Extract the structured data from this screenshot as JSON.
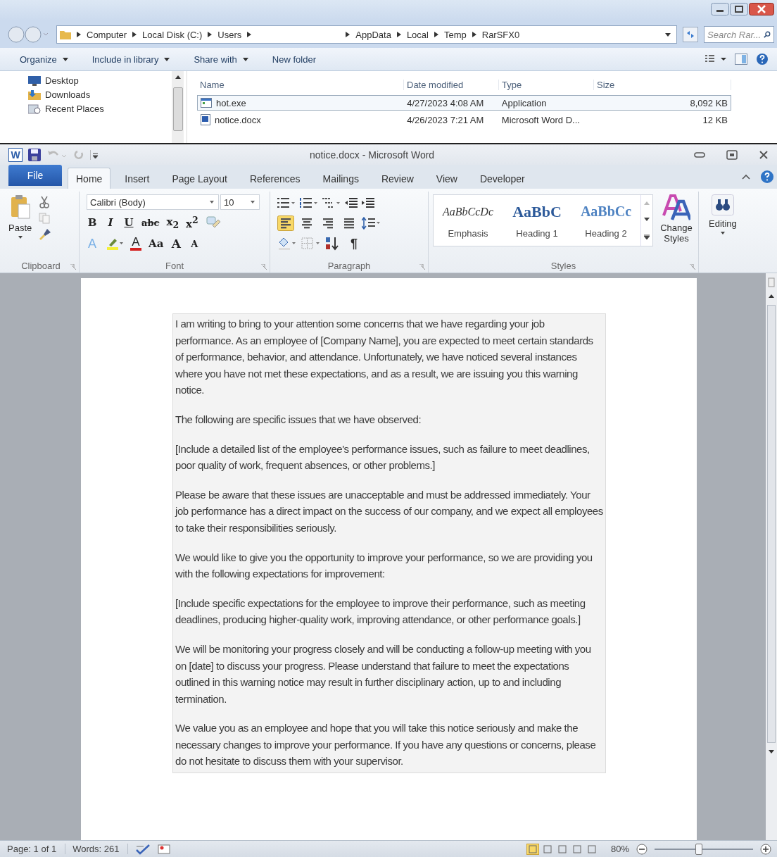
{
  "explorer": {
    "breadcrumb": [
      {
        "kind": "crumb",
        "label": "Computer"
      },
      {
        "kind": "crumb",
        "label": "Local Disk (C:)"
      },
      {
        "kind": "crumb",
        "label": "Users"
      },
      {
        "kind": "blank"
      },
      {
        "kind": "crumb",
        "label": "AppData"
      },
      {
        "kind": "crumb",
        "label": "Local"
      },
      {
        "kind": "crumb",
        "label": "Temp"
      },
      {
        "kind": "crumb",
        "label": "RarSFX0"
      }
    ],
    "search": {
      "placeholder": "Search Rar..."
    },
    "toolbar": [
      {
        "label": "Organize",
        "dropdown": true
      },
      {
        "label": "Include in library",
        "dropdown": true
      },
      {
        "label": "Share with",
        "dropdown": true
      },
      {
        "label": "New folder",
        "dropdown": false
      }
    ],
    "nav": [
      {
        "label": "Desktop",
        "kind": "desktop"
      },
      {
        "label": "Downloads",
        "kind": "downloads"
      },
      {
        "label": "Recent Places",
        "kind": "recent"
      }
    ],
    "columns": [
      "Name",
      "Date modified",
      "Type",
      "Size"
    ],
    "files": [
      {
        "name": "hot.exe",
        "kind": "exe",
        "date": "4/27/2023 4:08 AM",
        "type": "Application",
        "size": "8,092 KB",
        "selected": true
      },
      {
        "name": "notice.docx",
        "kind": "doc",
        "date": "4/26/2023 7:21 AM",
        "type": "Microsoft Word D...",
        "size": "12 KB",
        "selected": false
      }
    ]
  },
  "word": {
    "logo": "W",
    "title": "notice.docx - Microsoft Word",
    "tabs": [
      {
        "label": "File",
        "kind": "file",
        "selected": false
      },
      {
        "label": "Home",
        "kind": "tab",
        "selected": true
      },
      {
        "label": "Insert",
        "kind": "tab",
        "selected": false
      },
      {
        "label": "Page Layout",
        "kind": "tab",
        "selected": false
      },
      {
        "label": "References",
        "kind": "tab",
        "selected": false
      },
      {
        "label": "Mailings",
        "kind": "tab",
        "selected": false
      },
      {
        "label": "Review",
        "kind": "tab",
        "selected": false
      },
      {
        "label": "View",
        "kind": "tab",
        "selected": false
      },
      {
        "label": "Developer",
        "kind": "tab",
        "selected": false
      }
    ],
    "clipboard": {
      "label": "Clipboard",
      "paste": "Paste"
    },
    "font": {
      "label": "Font",
      "name": "Calibri (Body)",
      "size": "10",
      "row1": [
        {
          "kind": "bold",
          "text": "B"
        },
        {
          "kind": "italic",
          "text": "I"
        },
        {
          "kind": "underline",
          "text": "U"
        },
        {
          "kind": "strike",
          "text": "abc"
        },
        {
          "kind": "plain",
          "text": "x$_{2}$"
        },
        {
          "kind": "plain",
          "text": "x$^{2}$"
        }
      ],
      "row2": [
        {
          "kind": "effects",
          "text": "A"
        },
        {
          "kind": "highlight"
        },
        {
          "kind": "color",
          "text": "A"
        },
        {
          "kind": "plain",
          "text": "Aa"
        },
        {
          "kind": "grow",
          "text": "A"
        },
        {
          "kind": "shrink",
          "text": "A"
        }
      ]
    },
    "paragraph": {
      "label": "Paragraph",
      "align": [
        {
          "kind": "left",
          "selected": true
        },
        {
          "kind": "center",
          "selected": false
        },
        {
          "kind": "right",
          "selected": false
        },
        {
          "kind": "justify",
          "selected": false
        }
      ],
      "pilcrow": "¶"
    },
    "styles": {
      "label": "Styles",
      "gallery": [
        {
          "kind": "emphasis",
          "sample": "AaBbCcDc",
          "name": "Emphasis"
        },
        {
          "kind": "heading1",
          "sample": "AaBbC",
          "name": "Heading 1"
        },
        {
          "kind": "heading2",
          "sample": "AaBbCc",
          "name": "Heading 2"
        }
      ],
      "change": "Change Styles"
    },
    "editing": "Editing",
    "paragraphs": [
      "I am writing to bring to your attention some concerns that we have regarding your job performance. As an employee of [Company Name], you are expected to meet certain standards of performance, behavior, and attendance. Unfortunately, we have noticed several instances where you have not met these expectations, and as a result, we are issuing you this warning notice.",
      "The following are specific issues that we have observed:",
      "[Include a detailed list of the employee's performance issues, such as failure to meet deadlines, poor quality of work, frequent absences, or other problems.]",
      "Please be aware that these issues are unacceptable and must be addressed immediately. Your job performance has a direct impact on the success of our company, and we expect all employees to take their responsibilities seriously.",
      "We would like to give you the opportunity to improve your performance, so we are providing you with the following expectations for improvement:",
      "[Include specific expectations for the employee to improve their performance, such as meeting deadlines, producing higher-quality work, improving attendance, or other performance goals.]",
      "We will be monitoring your progress closely and will be conducting a follow-up meeting with you on [date] to discuss your progress. Please understand that failure to meet the expectations outlined in this warning notice may result in further disciplinary action, up to and including termination.",
      "We value you as an employee and hope that you will take this notice seriously and make the necessary changes to improve your performance. If you have any questions or concerns, please do not hesitate to discuss them with your supervisor."
    ],
    "status": {
      "page": "Page: 1 of 1",
      "words": "Words: 261",
      "views": [
        {
          "selected": true
        },
        {
          "selected": false
        },
        {
          "selected": false
        },
        {
          "selected": false
        },
        {
          "selected": false
        }
      ],
      "zoom": "80%",
      "zoom_slider": {
        "level": 0.45
      }
    }
  }
}
